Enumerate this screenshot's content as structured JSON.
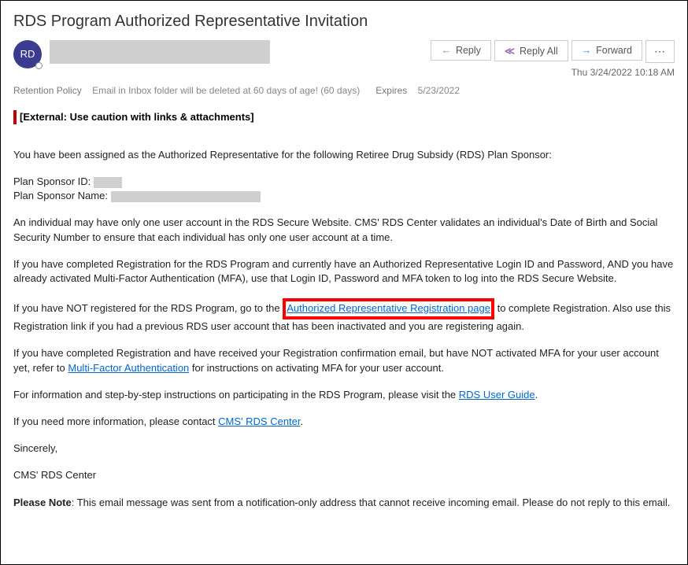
{
  "subject": "RDS Program Authorized Representative Invitation",
  "avatar_initials": "RD",
  "actions": {
    "reply": "Reply",
    "reply_all": "Reply All",
    "forward": "Forward",
    "more": "⋯"
  },
  "timestamp": "Thu 3/24/2022 10:18 AM",
  "meta": {
    "retention_label": "Retention Policy",
    "retention_value": "Email in Inbox folder will be deleted at 60 days of age! (60 days)",
    "expires_label": "Expires",
    "expires_value": "5/23/2022"
  },
  "external_banner": "[External: Use caution with links & attachments]",
  "body": {
    "p1": "You have been assigned as the Authorized Representative for the following Retiree Drug Subsidy (RDS) Plan Sponsor:",
    "sponsor_id_label": "Plan Sponsor ID: ",
    "sponsor_name_label": "Plan Sponsor Name: ",
    "p2": "An individual may have only one user account in the RDS Secure Website. CMS' RDS Center validates an individual's Date of Birth and Social Security Number to ensure that each individual has only one user account at a time.",
    "p3": "If you have completed Registration for the RDS Program and currently have an Authorized Representative Login ID and Password, AND you have already activated Multi-Factor Authentication (MFA), use that Login ID, Password and MFA token to log into the RDS Secure Website.",
    "p4_a": "If you have NOT registered for the RDS Program, go to the ",
    "p4_link": "Authorized Representative Registration page",
    "p4_b": " to complete Registration. Also use this Registration link if you had a previous RDS user account that has been inactivated and you are registering again.",
    "p5_a": "If you have completed Registration and have received your Registration confirmation email, but have NOT activated MFA for your user account yet, refer to ",
    "p5_link": "Multi-Factor Authentication",
    "p5_b": " for instructions on activating MFA for your user account.",
    "p6_a": "For information and step-by-step instructions on participating in the RDS Program, please visit the ",
    "p6_link": "RDS User Guide",
    "p6_b": ".",
    "p7_a": "If you need more information, please contact ",
    "p7_link": "CMS' RDS Center",
    "p7_b": ".",
    "p8": "Sincerely,",
    "p9": "CMS' RDS Center",
    "note_label": "Please Note",
    "note_text": ": This email message was sent from a notification-only address that cannot receive incoming email. Please do not reply to this email."
  }
}
